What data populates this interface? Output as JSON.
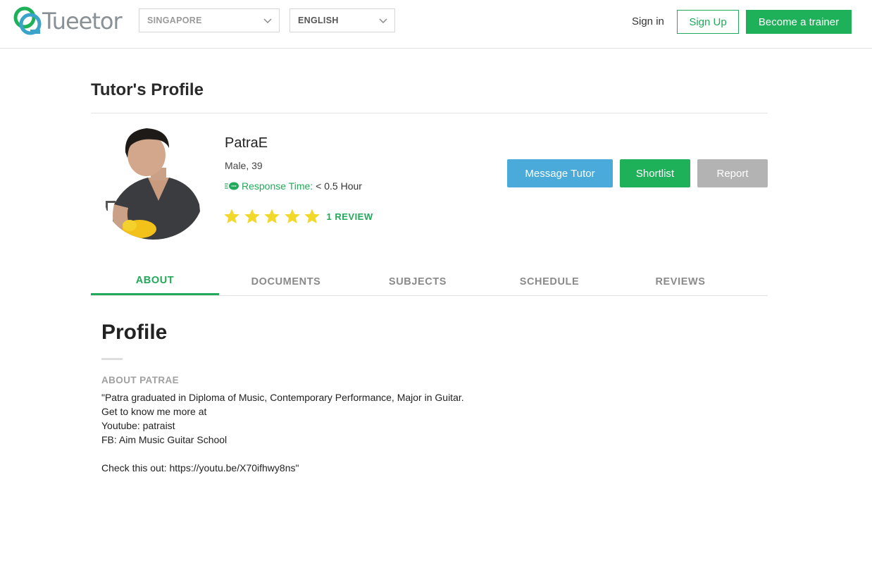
{
  "header": {
    "logo_text": "Tueetor",
    "country_select": "SINGAPORE",
    "language_select": "ENGLISH",
    "signin_label": "Sign in",
    "signup_label": "Sign Up",
    "trainer_label": "Become a trainer"
  },
  "page": {
    "title": "Tutor's Profile"
  },
  "tutor": {
    "name": "PatraE",
    "gender_age": "Male, 39",
    "response_label": "Response Time:",
    "response_value": "< 0.5 Hour",
    "rating_stars": 5,
    "review_link": "1 REVIEW"
  },
  "actions": {
    "message_label": "Message Tutor",
    "shortlist_label": "Shortlist",
    "report_label": "Report"
  },
  "tabs": [
    {
      "label": "ABOUT",
      "active": true
    },
    {
      "label": "DOCUMENTS",
      "active": false
    },
    {
      "label": "SUBJECTS",
      "active": false
    },
    {
      "label": "SCHEDULE",
      "active": false
    },
    {
      "label": "REVIEWS",
      "active": false
    }
  ],
  "profile": {
    "heading": "Profile",
    "about_label": "ABOUT PATRAE",
    "about_text": "\"Patra graduated in Diploma of Music, Contemporary Performance, Major in Guitar.\nGet to know me more at\nYoutube: patraist\nFB: Aim Music Guitar School\n\nCheck this out: https://youtu.be/X70ifhwy8ns\""
  },
  "colors": {
    "brand_green": "#1fb15a",
    "message_blue": "#4aabdb",
    "report_gray": "#b3b3b3",
    "star_yellow": "#f2d82b"
  }
}
